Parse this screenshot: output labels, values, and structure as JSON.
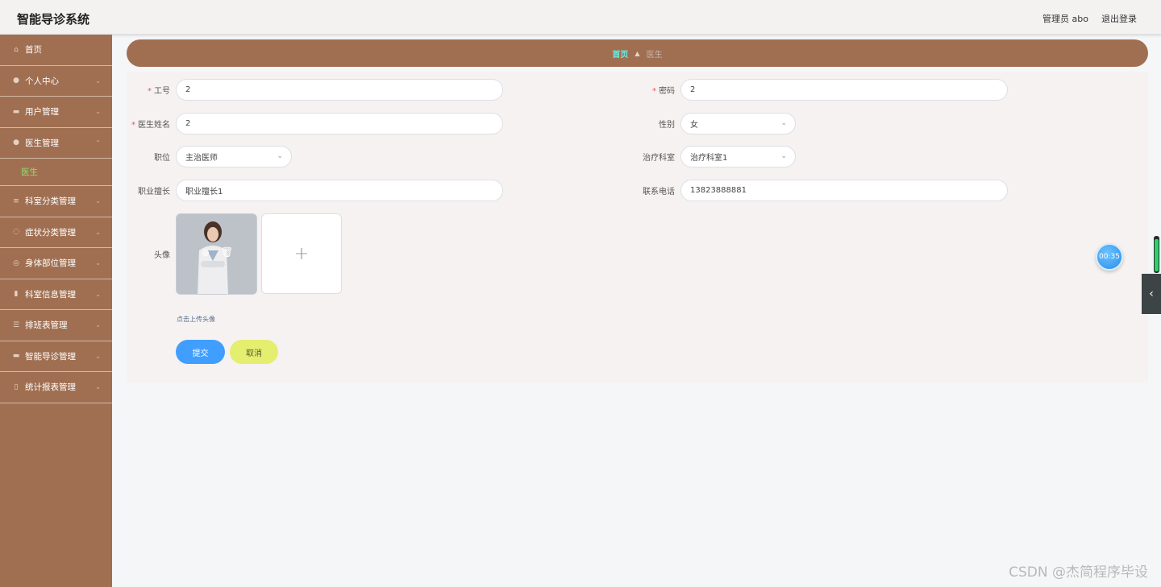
{
  "header": {
    "title": "智能导诊系统",
    "user": "管理员 abo",
    "logout": "退出登录"
  },
  "sidebar": {
    "items": [
      {
        "label": "首页",
        "icon": "home-icon"
      },
      {
        "label": "个人中心",
        "icon": "user-icon"
      },
      {
        "label": "用户管理",
        "icon": "users-icon"
      },
      {
        "label": "医生管理",
        "icon": "doctor-icon"
      },
      {
        "label": "医生",
        "icon": ""
      },
      {
        "label": "科室分类管理",
        "icon": "list-icon"
      },
      {
        "label": "症状分类管理",
        "icon": "power-icon"
      },
      {
        "label": "身体部位管理",
        "icon": "compass-icon"
      },
      {
        "label": "科室信息管理",
        "icon": "chart-icon"
      },
      {
        "label": "排班表管理",
        "icon": "sliders-icon"
      },
      {
        "label": "智能导诊管理",
        "icon": "briefcase-icon"
      },
      {
        "label": "统计报表管理",
        "icon": "trash-icon"
      }
    ]
  },
  "breadcrumb": {
    "home": "首页",
    "current": "医生"
  },
  "form": {
    "job_no": {
      "label": "工号",
      "value": "2"
    },
    "password": {
      "label": "密码",
      "value": "2"
    },
    "doctor_name": {
      "label": "医生姓名",
      "value": "2"
    },
    "gender": {
      "label": "性别",
      "value": "女"
    },
    "position": {
      "label": "职位",
      "value": "主治医师"
    },
    "department": {
      "label": "治疗科室",
      "value": "治疗科室1"
    },
    "specialty": {
      "label": "职业擅长",
      "value": "职业擅长1"
    },
    "phone": {
      "label": "联系电话",
      "value": "13823888881"
    },
    "avatar": {
      "label": "头像",
      "hint": "点击上传头像"
    },
    "submit": "提交",
    "cancel": "取消"
  },
  "overlay": {
    "timer": "00:35"
  },
  "watermark": "CSDN @杰简程序毕设",
  "colors": {
    "brand": "#a06f52",
    "primary": "#409eff",
    "cancel": "#e4ee6f",
    "active": "#8be36a"
  }
}
